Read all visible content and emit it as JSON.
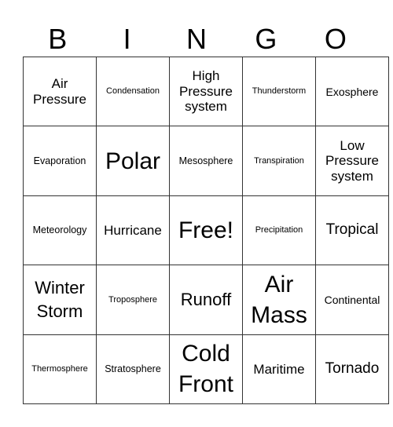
{
  "header": [
    "B",
    "I",
    "N",
    "G",
    "O"
  ],
  "rows": [
    [
      "Air Pressure",
      "Condensation",
      "High Pressure system",
      "Thunderstorm",
      "Exosphere"
    ],
    [
      "Evaporation",
      "Polar",
      "Mesosphere",
      "Transpiration",
      "Low Pressure system"
    ],
    [
      "Meteorology",
      "Hurricane",
      "Free!",
      "Precipitation",
      "Tropical"
    ],
    [
      "Winter Storm",
      "Troposphere",
      "Runoff",
      "Air Mass",
      "Continental"
    ],
    [
      "Thermosphere",
      "Stratosphere",
      "Cold Front",
      "Maritime",
      "Tornado"
    ]
  ]
}
